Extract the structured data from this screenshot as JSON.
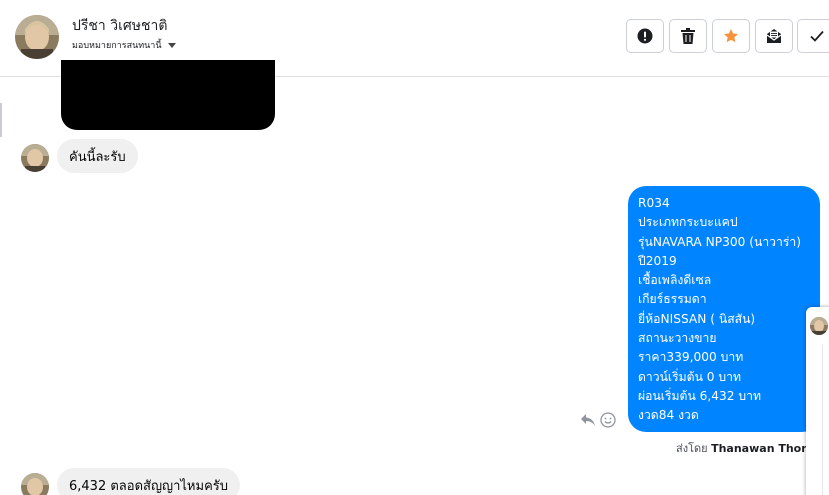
{
  "header": {
    "contact_name": "ปรีชา วิเศษชาติ",
    "assign_label": "มอบหมายการสนทนานี้",
    "actions": [
      {
        "name": "alert-button",
        "icon": "exclamation-icon"
      },
      {
        "name": "delete-button",
        "icon": "trash-icon"
      },
      {
        "name": "star-button",
        "icon": "star-icon"
      },
      {
        "name": "mark-unread-button",
        "icon": "envelope-open-icon"
      },
      {
        "name": "done-button",
        "icon": "check-icon"
      }
    ]
  },
  "messages": {
    "incoming_1": "คันนี้ละรับ",
    "incoming_2": "6,432 ตลอดสัญญาไหมครับ",
    "outgoing_lines": [
      "R034",
      "ประเภทกระบะแคป",
      "รุ่นNAVARA NP300 (นาวาร่า)",
      "ปี2019",
      "เชื้อเพลิงดีเซล",
      "เกียร์ธรรมดา",
      "ยี่ห้อNISSAN ( นิสสัน)",
      "สถานะวางขาย",
      "ราคา339,000 บาท",
      "ดาวน์เริ่มต้น 0 บาท",
      "ผ่อนเริ่มต้น 6,432 บาท",
      "งวด84 งวด"
    ],
    "sent_by_prefix": "ส่งโดย",
    "sent_by_name": "Thanawan Thon"
  },
  "colors": {
    "outgoing_bubble": "#0084ff",
    "incoming_bubble": "#f1f0f0",
    "star": "#f7923b"
  }
}
